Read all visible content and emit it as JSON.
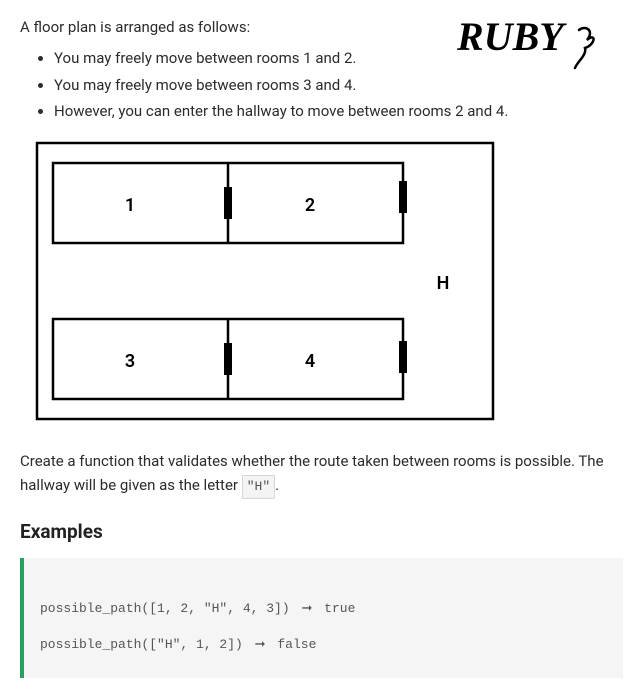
{
  "language_badge": "RUBY",
  "intro": "A floor plan is arranged as follows:",
  "bullets": [
    "You may freely move between rooms 1 and 2.",
    "You may freely move between rooms 3 and 4.",
    "However, you can enter the hallway to move between rooms 2 and 4."
  ],
  "floorplan": {
    "rooms": {
      "r1": "1",
      "r2": "2",
      "r3": "3",
      "r4": "4",
      "hallway": "H"
    }
  },
  "description_pre": "Create a function that validates whether the route taken between rooms is possible. The hallway will be given as the letter ",
  "description_code": "\"H\"",
  "description_post": ".",
  "examples_heading": "Examples",
  "code": {
    "line1_call": "possible_path([1, 2, \"H\", 4, 3])",
    "arrow": "➞",
    "line1_result": "true",
    "line2_call": "possible_path([\"H\", 1, 2])",
    "line2_result": "false"
  }
}
